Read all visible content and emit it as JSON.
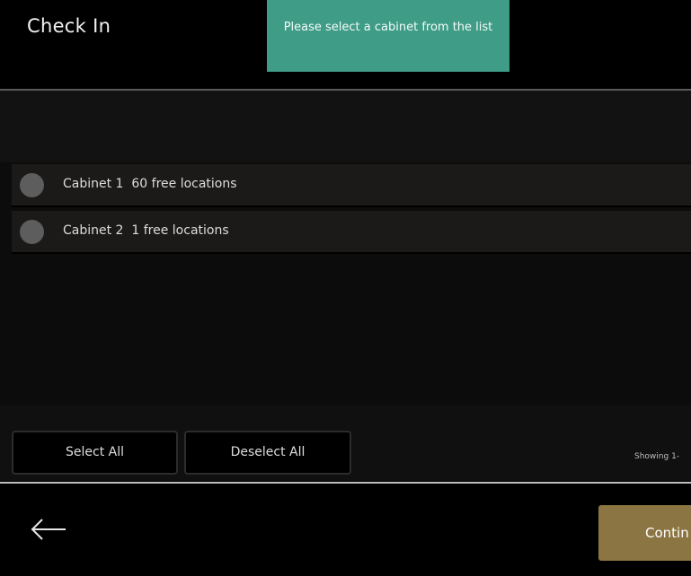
{
  "header": {
    "title": "Check In",
    "toast": "Please select a cabinet from the list"
  },
  "cabinets": [
    {
      "name": "Cabinet 1",
      "free": "60 free locations"
    },
    {
      "name": "Cabinet 2",
      "free": "1 free locations"
    }
  ],
  "actions": {
    "select_all": "Select All",
    "deselect_all": "Deselect All",
    "showing": "Showing 1-"
  },
  "footer": {
    "back_icon": "arrow-left-icon",
    "continue_label": "Contin"
  },
  "colors": {
    "toast_bg": "#3f9c86",
    "continue_bg": "#8b7542",
    "row_bg": "#1c1a18"
  }
}
